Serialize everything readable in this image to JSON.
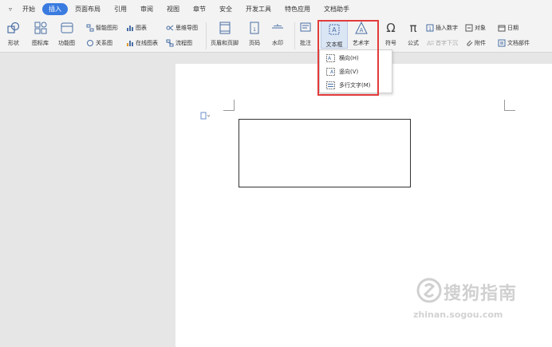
{
  "menu": {
    "tabs": [
      "开始",
      "插入",
      "页面布局",
      "引用",
      "审阅",
      "视图",
      "章节",
      "安全",
      "开发工具",
      "特色应用",
      "文档助手"
    ],
    "active_tab": "插入"
  },
  "ribbon": {
    "shape": "形状",
    "icon_lib": "图标库",
    "func_chart": "功能图",
    "smart_shape": "智能图形",
    "chart": "图表",
    "mind_map": "思维导图",
    "relation": "关系图",
    "online_chart": "在线图表",
    "flowchart": "流程图",
    "header_footer": "页眉和页脚",
    "page_num": "页码",
    "watermark_btn": "水印",
    "comment": "批注",
    "textbox": "文本框",
    "wordart": "艺术字",
    "symbol": "符号",
    "formula": "公式",
    "insert_number": "插入数字",
    "first_sink": "首字下沉",
    "object": "对象",
    "attachment": "附件",
    "date": "日期",
    "doc_parts": "文档部件"
  },
  "textbox_menu": {
    "horizontal": "横向(H)",
    "vertical": "竖向(V)",
    "multiline": "多行文字(M)"
  },
  "watermark": {
    "brand": "搜狗指南",
    "url": "zhinan.sogou.com"
  },
  "colors": {
    "accent": "#3a7be0",
    "highlight_frame": "#e23b3b"
  }
}
